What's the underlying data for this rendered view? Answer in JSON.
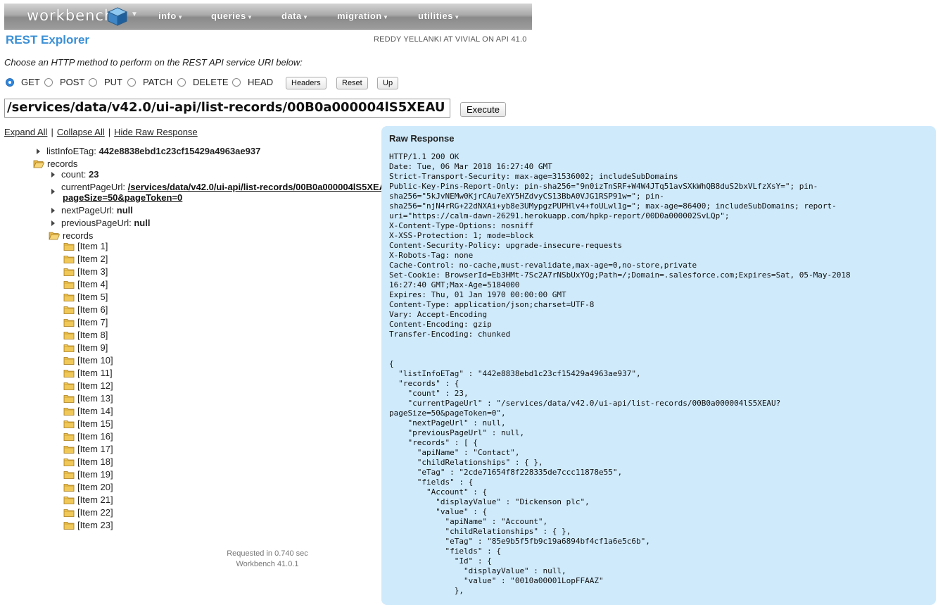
{
  "nav": {
    "logo": "workbench",
    "items": [
      "info",
      "queries",
      "data",
      "migration",
      "utilities"
    ]
  },
  "page_title": "REST Explorer",
  "user_info": "REDDY YELLANKI AT VIVIAL ON API 41.0",
  "instruction": "Choose an HTTP method to perform on the REST API service URI below:",
  "methods": [
    "GET",
    "POST",
    "PUT",
    "PATCH",
    "DELETE",
    "HEAD"
  ],
  "selected_method": "GET",
  "buttons": {
    "headers": "Headers",
    "reset": "Reset",
    "up": "Up",
    "execute": "Execute"
  },
  "uri": "/services/data/v42.0/ui-api/list-records/00B0a000004lS5XEAU",
  "links": {
    "expand_all": "Expand All",
    "collapse_all": "Collapse All",
    "hide_raw": "Hide Raw Response"
  },
  "tree": {
    "listInfoETag_label": "listInfoETag:",
    "listInfoETag_value": "442e8838ebd1c23cf15429a4963ae937",
    "records_label": "records",
    "count_label": "count:",
    "count_value": "23",
    "currentPageUrl_label": "currentPageUrl:",
    "currentPageUrl_value_line1": "/services/data/v42.0/ui-api/list-records/00B0a000004lS5XEAU?",
    "currentPageUrl_value_line2": "pageSize=50&pageToken=0",
    "nextPageUrl_label": "nextPageUrl:",
    "nextPageUrl_value": "null",
    "previousPageUrl_label": "previousPageUrl:",
    "previousPageUrl_value": "null",
    "inner_records_label": "records",
    "items": [
      "[Item 1]",
      "[Item 2]",
      "[Item 3]",
      "[Item 4]",
      "[Item 5]",
      "[Item 6]",
      "[Item 7]",
      "[Item 8]",
      "[Item 9]",
      "[Item 10]",
      "[Item 11]",
      "[Item 12]",
      "[Item 13]",
      "[Item 14]",
      "[Item 15]",
      "[Item 16]",
      "[Item 17]",
      "[Item 18]",
      "[Item 19]",
      "[Item 20]",
      "[Item 21]",
      "[Item 22]",
      "[Item 23]"
    ]
  },
  "footer": {
    "requested": "Requested in 0.740 sec",
    "version": "Workbench 41.0.1"
  },
  "raw": {
    "title": "Raw Response",
    "body": "HTTP/1.1 200 OK\nDate: Tue, 06 Mar 2018 16:27:40 GMT\nStrict-Transport-Security: max-age=31536002; includeSubDomains\nPublic-Key-Pins-Report-Only: pin-sha256=\"9n0izTnSRF+W4W4JTq51avSXkWhQB8duS2bxVLfzXsY=\"; pin-\nsha256=\"5kJvNEMw0KjrCAu7eXY5HZdvyCS13BbA0VJG1RSP91w=\"; pin-\nsha256=\"njN4rRG+22dNXAi+yb8e3UMypgzPUPHlv4+foULwl1g=\"; max-age=86400; includeSubDomains; report-\nuri=\"https://calm-dawn-26291.herokuapp.com/hpkp-report/00D0a000002SvLQp\";\nX-Content-Type-Options: nosniff\nX-XSS-Protection: 1; mode=block\nContent-Security-Policy: upgrade-insecure-requests\nX-Robots-Tag: none\nCache-Control: no-cache,must-revalidate,max-age=0,no-store,private\nSet-Cookie: BrowserId=Eb3HMt-7Sc2A7rNSbUxYOg;Path=/;Domain=.salesforce.com;Expires=Sat, 05-May-2018\n16:27:40 GMT;Max-Age=5184000\nExpires: Thu, 01 Jan 1970 00:00:00 GMT\nContent-Type: application/json;charset=UTF-8\nVary: Accept-Encoding\nContent-Encoding: gzip\nTransfer-Encoding: chunked\n\n\n{\n  \"listInfoETag\" : \"442e8838ebd1c23cf15429a4963ae937\",\n  \"records\" : {\n    \"count\" : 23,\n    \"currentPageUrl\" : \"/services/data/v42.0/ui-api/list-records/00B0a000004lS5XEAU?\npageSize=50&pageToken=0\",\n    \"nextPageUrl\" : null,\n    \"previousPageUrl\" : null,\n    \"records\" : [ {\n      \"apiName\" : \"Contact\",\n      \"childRelationships\" : { },\n      \"eTag\" : \"2cde71654f8f228335de7ccc11878e55\",\n      \"fields\" : {\n        \"Account\" : {\n          \"displayValue\" : \"Dickenson plc\",\n          \"value\" : {\n            \"apiName\" : \"Account\",\n            \"childRelationships\" : { },\n            \"eTag\" : \"85e9b5f5fb9c19a6894bf4cf1a6e5c6b\",\n            \"fields\" : {\n              \"Id\" : {\n                \"displayValue\" : null,\n                \"value\" : \"0010a00001LopFFAAZ\"\n              },"
  }
}
